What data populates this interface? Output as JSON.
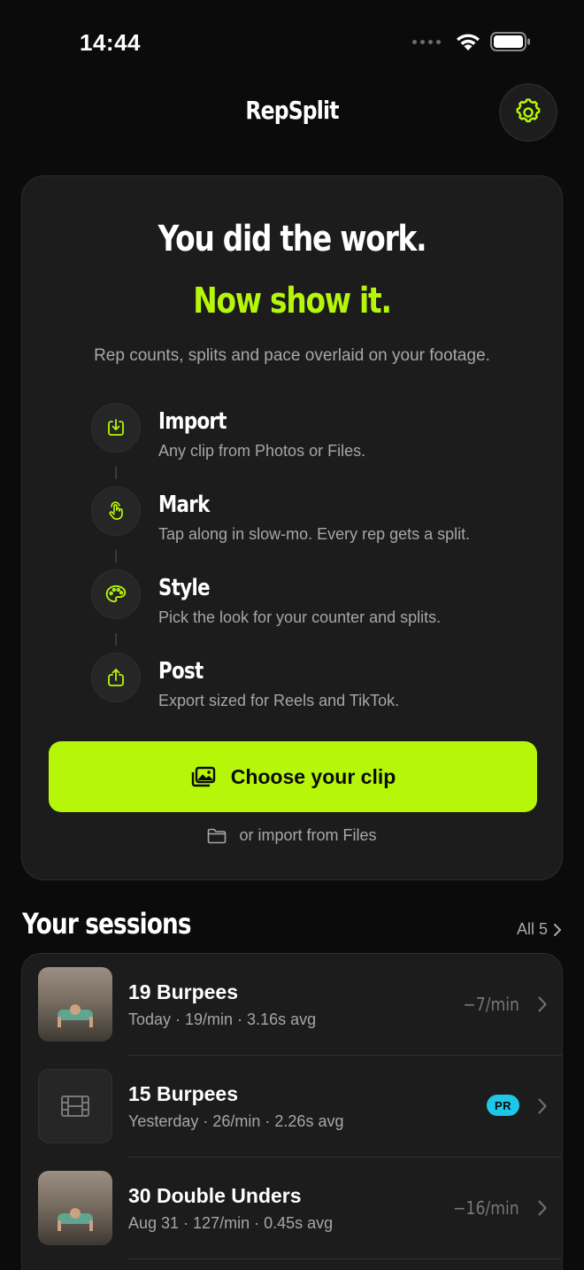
{
  "status_bar": {
    "time": "14:44"
  },
  "header": {
    "title": "RepSplit"
  },
  "hero": {
    "title": "You did the work.",
    "accent": "Now show it.",
    "subtitle": "Rep counts, splits and pace overlaid on your footage.",
    "steps": [
      {
        "title": "Import",
        "description": "Any clip from Photos or Files.",
        "icon": "import-icon"
      },
      {
        "title": "Mark",
        "description": "Tap along in slow-mo. Every rep gets a split.",
        "icon": "tap-hand-icon"
      },
      {
        "title": "Style",
        "description": "Pick the look for your counter and splits.",
        "icon": "palette-icon"
      },
      {
        "title": "Post",
        "description": "Export sized for Reels and TikTok.",
        "icon": "share-icon"
      }
    ],
    "primary_button": "Choose your clip",
    "secondary_link": "or import from Files"
  },
  "sessions": {
    "title": "Your sessions",
    "all_label": "All 5",
    "items": [
      {
        "name": "19 Burpees",
        "meta": "Today · 19/min · 3.16s avg",
        "pace": "−7/min",
        "thumb": "photo"
      },
      {
        "name": "15 Burpees",
        "meta": "Yesterday · 26/min · 2.26s avg",
        "badge": "PR",
        "thumb": "film-icon"
      },
      {
        "name": "30 Double Unders",
        "meta": "Aug 31 · 127/min · 0.45s avg",
        "pace": "−16/min",
        "thumb": "photo"
      }
    ]
  },
  "colors": {
    "accent": "#b6f608",
    "background": "#0b0b0b",
    "card": "#1c1c1c",
    "pr_badge": "#1ec7e8"
  }
}
